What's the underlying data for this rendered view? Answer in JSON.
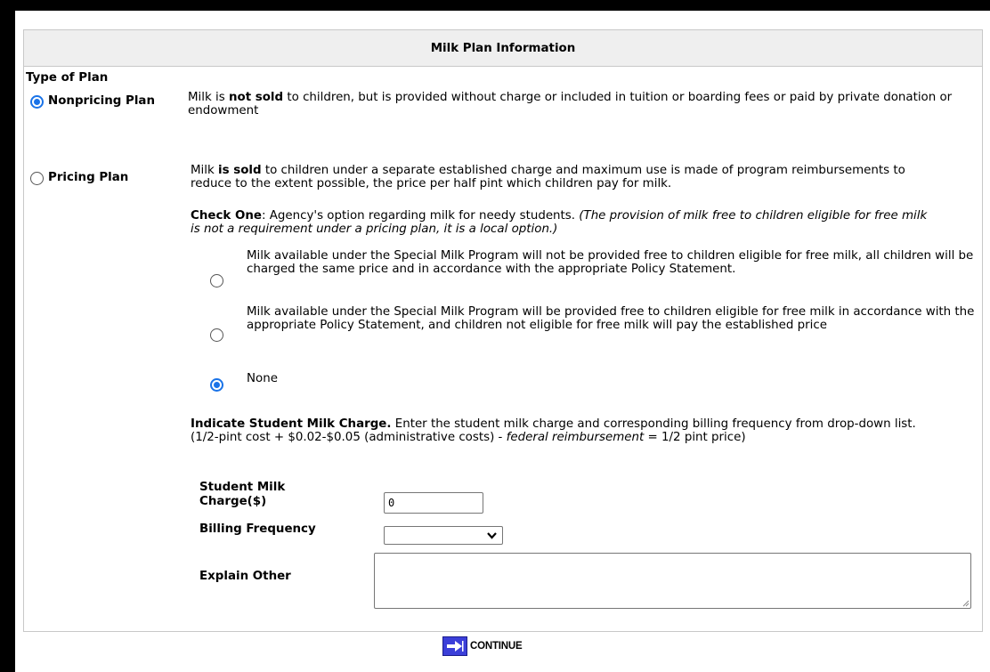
{
  "panel": {
    "title": "Milk Plan Information"
  },
  "type_of_plan": {
    "heading": "Type of Plan",
    "nonpricing": {
      "label": "Nonpricing Plan",
      "checked": true,
      "desc_pre": "Milk is ",
      "desc_bold": "not sold",
      "desc_post": " to children, but is provided without charge or included in tuition or boarding fees or paid by private donation or endowment"
    },
    "pricing": {
      "label": "Pricing Plan",
      "checked": false,
      "desc_pre": "Milk ",
      "desc_bold": "is sold",
      "desc_post": " to children under a separate established charge and maximum use is made of program reimbursements to reduce to the extent possible, the price per half pint which children pay for milk."
    }
  },
  "check_one": {
    "title": "Check One",
    "text": ": Agency's option regarding milk for needy students. ",
    "italic": "(The provision of milk free to children eligible for free milk is not a requirement under a pricing plan, it is a local option.)",
    "options": [
      {
        "label": "Milk available under the Special Milk Program will not be provided free to children eligible for free milk, all children will be charged the same price and in accordance with the appropriate Policy Statement.",
        "checked": false
      },
      {
        "label": "Milk available under the Special Milk Program will be provided free to children eligible for free milk in accordance with the appropriate Policy Statement, and children not eligible for free milk will pay the established price",
        "checked": false
      },
      {
        "label": "None",
        "checked": true
      }
    ]
  },
  "charge": {
    "title": "Indicate Student Milk Charge.",
    "text": " Enter the student milk charge and corresponding billing frequency from drop-down list. (1/2-pint cost + $0.02-$0.05 (administrative costs) - ",
    "italic": "federal reimbursement",
    "text_end": " = 1/2 pint price)",
    "student_charge_label": "Student Milk Charge($)",
    "student_charge_value": "0",
    "billing_label": "Billing Frequency",
    "billing_value": "",
    "explain_label": "Explain Other",
    "explain_value": ""
  },
  "continue": {
    "label": "CONTINUE"
  },
  "colors": {
    "accent": "#1a73e8",
    "header_bg": "#efefef",
    "continue_icon": "#3b3fd9"
  }
}
